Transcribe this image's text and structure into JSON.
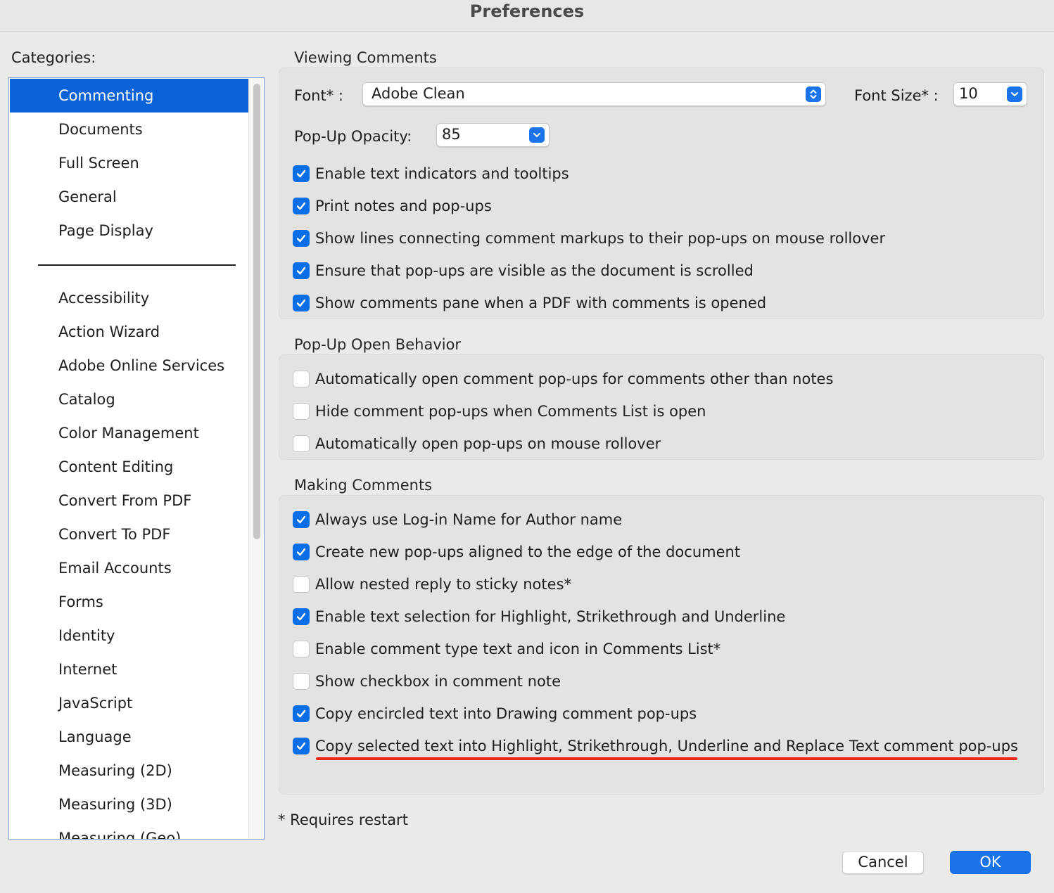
{
  "window": {
    "title": "Preferences"
  },
  "categories": {
    "label": "Categories:",
    "primary": [
      "Commenting",
      "Documents",
      "Full Screen",
      "General",
      "Page Display"
    ],
    "selected": "Commenting",
    "secondary": [
      "Accessibility",
      "Action Wizard",
      "Adobe Online Services",
      "Catalog",
      "Color Management",
      "Content Editing",
      "Convert From PDF",
      "Convert To PDF",
      "Email Accounts",
      "Forms",
      "Identity",
      "Internet",
      "JavaScript",
      "Language",
      "Measuring (2D)",
      "Measuring (3D)",
      "Measuring (Geo)"
    ]
  },
  "viewing": {
    "title": "Viewing Comments",
    "font_label": "Font* :",
    "font_value": "Adobe Clean",
    "font_size_label": "Font Size* :",
    "font_size_value": "10",
    "opacity_label": "Pop-Up Opacity:",
    "opacity_value": "85",
    "options": [
      {
        "label": "Enable text indicators and tooltips",
        "checked": true
      },
      {
        "label": "Print notes and pop-ups",
        "checked": true
      },
      {
        "label": "Show lines connecting comment markups to their pop-ups on mouse rollover",
        "checked": true
      },
      {
        "label": "Ensure that pop-ups are visible as the document is scrolled",
        "checked": true
      },
      {
        "label": "Show comments pane when a PDF with comments is opened",
        "checked": true
      }
    ]
  },
  "popup": {
    "title": "Pop-Up Open Behavior",
    "options": [
      {
        "label": "Automatically open comment pop-ups for comments other than notes",
        "checked": false
      },
      {
        "label": "Hide comment pop-ups when Comments List is open",
        "checked": false
      },
      {
        "label": "Automatically open pop-ups on mouse rollover",
        "checked": false
      }
    ]
  },
  "making": {
    "title": "Making Comments",
    "options": [
      {
        "label": "Always use Log-in Name for Author name",
        "checked": true
      },
      {
        "label": "Create new pop-ups aligned to the edge of the document",
        "checked": true
      },
      {
        "label": "Allow nested reply to sticky notes*",
        "checked": false
      },
      {
        "label": "Enable text selection for Highlight, Strikethrough and Underline",
        "checked": true
      },
      {
        "label": "Enable comment type text and icon in Comments List*",
        "checked": false
      },
      {
        "label": "Show checkbox in comment note",
        "checked": false
      },
      {
        "label": "Copy encircled text into Drawing comment pop-ups",
        "checked": true
      },
      {
        "label": "Copy selected text into Highlight, Strikethrough, Underline and Replace Text comment pop-ups",
        "checked": true
      }
    ]
  },
  "footer": {
    "note": "* Requires restart",
    "cancel_label": "Cancel",
    "ok_label": "OK"
  },
  "colors": {
    "accent": "#0a63d9",
    "highlight_underline": "#e8281c"
  },
  "icons": {
    "checked": "checkmark-icon",
    "stepper": "up-down-arrows-icon",
    "dropdown": "chevron-down-icon"
  }
}
